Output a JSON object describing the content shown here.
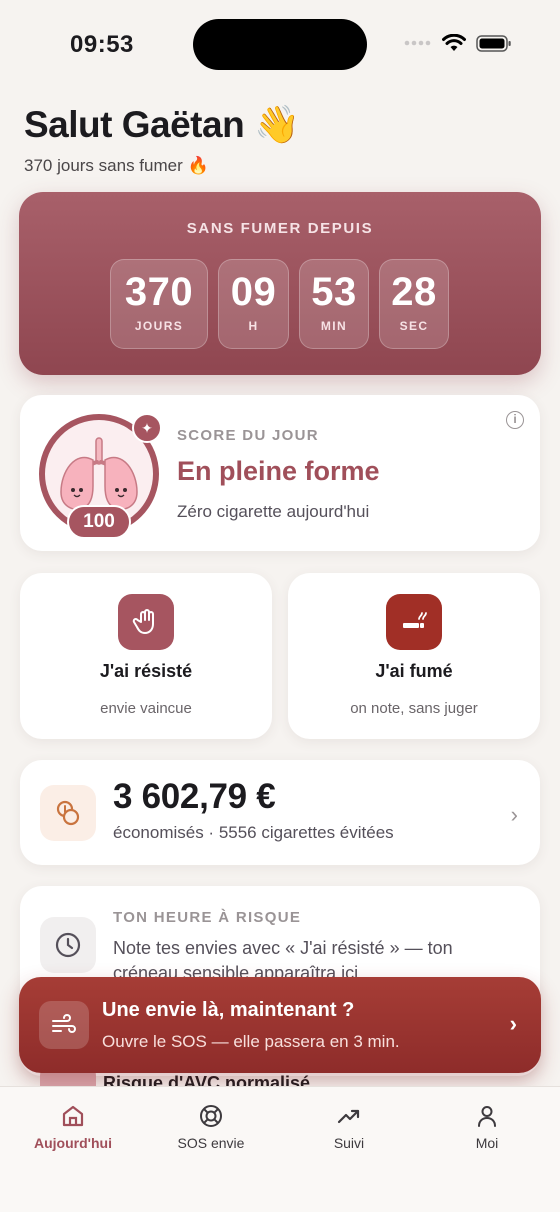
{
  "status_bar": {
    "time": "09:53"
  },
  "greeting": {
    "title": "Salut Gaëtan 👋",
    "subtitle": "370 jours sans fumer 🔥"
  },
  "timer": {
    "title": "SANS FUMER DEPUIS",
    "units": [
      {
        "value": "370",
        "label": "JOURS"
      },
      {
        "value": "09",
        "label": "H"
      },
      {
        "value": "53",
        "label": "MIN"
      },
      {
        "value": "28",
        "label": "SEC"
      }
    ]
  },
  "score": {
    "label": "SCORE DU JOUR",
    "status": "En pleine forme",
    "description": "Zéro cigarette aujourd'hui",
    "value": "100"
  },
  "actions": {
    "resisted": {
      "label": "J'ai résisté",
      "sub": "envie vaincue"
    },
    "smoked": {
      "label": "J'ai fumé",
      "sub": "on note, sans juger"
    }
  },
  "savings": {
    "amount": "3 602,79 €",
    "detail": "économisés · 5556 cigarettes évitées"
  },
  "risk_hour": {
    "title": "TON HEURE À RISQUE",
    "text": "Note tes envies avec « J'ai résisté » — ton créneau sensible apparaîtra ici."
  },
  "partial_card": {
    "text": "Risque d'AVC normalisé"
  },
  "sos": {
    "title": "Une envie là, maintenant ?",
    "subtitle": "Ouvre le SOS — elle passera en 3 min."
  },
  "tabs": [
    {
      "label": "Aujourd'hui",
      "icon": "home-icon",
      "active": true
    },
    {
      "label": "SOS envie",
      "icon": "lifebuoy-icon",
      "active": false
    },
    {
      "label": "Suivi",
      "icon": "trend-icon",
      "active": false
    },
    {
      "label": "Moi",
      "icon": "user-icon",
      "active": false
    }
  ],
  "colors": {
    "accent": "#a04f5a",
    "hero": "#9a5059",
    "sos": "#9a3430",
    "background": "#f6f3f0"
  }
}
